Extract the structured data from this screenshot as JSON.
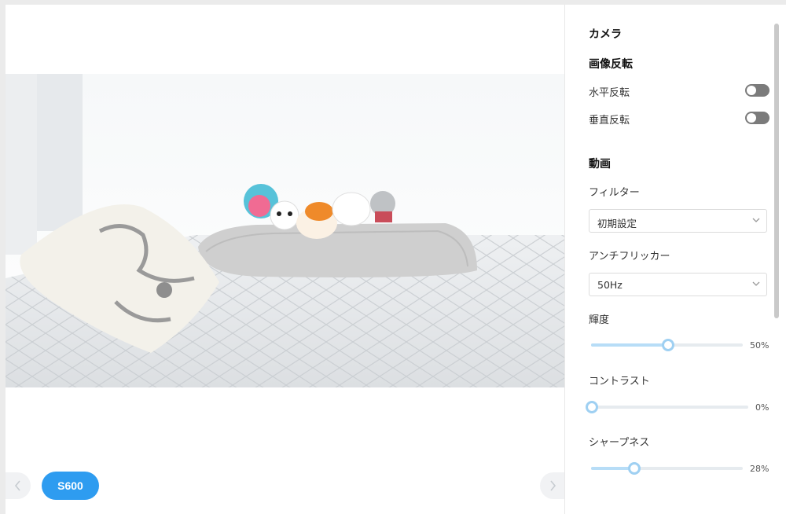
{
  "preview": {
    "device_label": "S600",
    "prev_icon": "chevron-left-icon",
    "next_icon": "chevron-right-icon"
  },
  "settings": {
    "camera_heading": "カメラ",
    "flip_heading": "画像反転",
    "horizontal_flip": {
      "label": "水平反転",
      "enabled": false
    },
    "vertical_flip": {
      "label": "垂直反転",
      "enabled": false
    },
    "video_heading": "動画",
    "filter": {
      "label": "フィルター",
      "value": "初期設定"
    },
    "anti_flicker": {
      "label": "アンチフリッカー",
      "value": "50Hz"
    },
    "brightness": {
      "label": "輝度",
      "value": 50,
      "display": "50%"
    },
    "contrast": {
      "label": "コントラスト",
      "value": 0,
      "display": "0%"
    },
    "sharpness": {
      "label": "シャープネス",
      "value": 28,
      "display": "28%"
    }
  },
  "colors": {
    "accent": "#2e9cf0",
    "slider_fill": "#b7ddf7",
    "slider_thumb": "#9fd0f2",
    "toggle_off": "#7b7b7b"
  }
}
